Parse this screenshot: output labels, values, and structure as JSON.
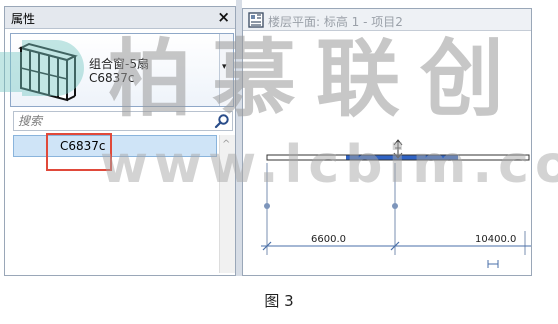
{
  "properties_panel": {
    "title": "属性",
    "close_glyph": "×",
    "type_selector": {
      "family": "组合窗-5扇",
      "type_name": "C6837c",
      "dropdown_glyph": "▾"
    },
    "search": {
      "placeholder": "搜索",
      "icon": "search-icon"
    },
    "results": [
      {
        "label": "C6837c"
      }
    ],
    "scroll_up_glyph": "^",
    "highlight_color": "#e0493a"
  },
  "view_window": {
    "title": "楼层平面: 标高 1 - 项目2",
    "icon": "floor-plan-view-icon",
    "dimensions": [
      "6600.0",
      "10400.0"
    ]
  },
  "watermark": {
    "brand_text": "柏慕联创",
    "url_text": "www.lcbim.com"
  },
  "caption": "图 3",
  "colors": {
    "selection_fill": "#cfe4f7",
    "wall_blue": "#2f63c4",
    "dimension_blue": "#4a6fa8",
    "watermark_gray": "#9a9a9a"
  }
}
